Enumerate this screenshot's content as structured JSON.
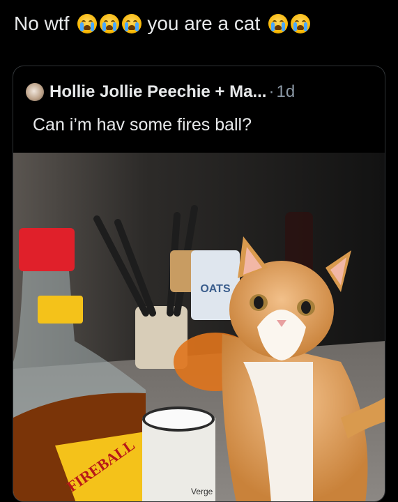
{
  "reply": {
    "text_before": "No wtf",
    "text_after": "you are a cat",
    "emoji_name": "loudly-crying-face-icon"
  },
  "quote": {
    "author": "Hollie Jollie Peechie + Ma...",
    "separator": "·",
    "time": "1d",
    "text": "Can i’m hav some fires ball?"
  },
  "photo": {
    "bottle_label": "FIREBALL",
    "oats_label": "OATS",
    "mug_label": "Verge",
    "colors": {
      "cat_fur": "#d99a4e",
      "bottle_cap": "#e0202a",
      "whisky": "#7a3408",
      "label_yellow": "#f4c21a"
    }
  }
}
